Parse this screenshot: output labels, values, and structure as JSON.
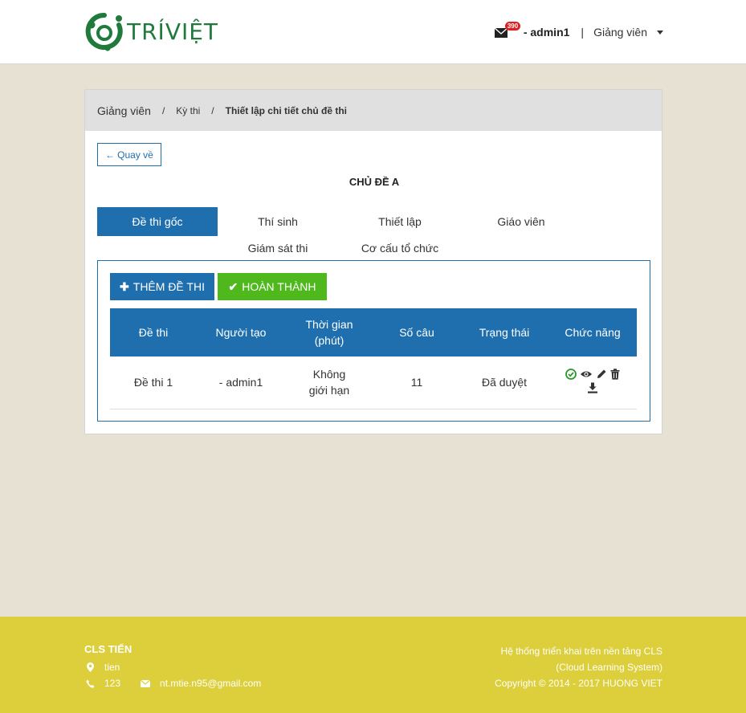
{
  "header": {
    "logo_text": "TRÍVIỆT",
    "mail_count": "390",
    "user": "- admin1",
    "separator": "|",
    "role": "Giảng viên"
  },
  "breadcrumb": {
    "items": [
      "Giảng viên",
      "Kỳ thi",
      "Thiết lập chi tiết chủ đề thi"
    ],
    "separator": "/"
  },
  "page": {
    "back_label": "Quay về",
    "title": "CHỦ ĐỀ A"
  },
  "tabs": [
    "Đề thi gốc",
    "Thí sinh",
    "Thiết lập",
    "Giáo viên",
    "Giám sát thi",
    "Cơ cấu tổ chức"
  ],
  "toolbar": {
    "add_label": "THÊM ĐỀ THI",
    "done_label": "HOÀN THÀNH"
  },
  "table": {
    "headers": [
      "Đề thi",
      "Người tạo",
      "Thời gian (phút)",
      "Số câu",
      "Trạng thái",
      "Chức năng"
    ],
    "rows": [
      [
        "Đề thi 1",
        "- admin1",
        "Không giới hạn",
        "11",
        "Đã duyệt"
      ]
    ]
  },
  "footer": {
    "brand": "CLS TIẾN",
    "address": "tien",
    "phone": "123",
    "email": "nt.mtie.n95@gmail.com",
    "right_line1": "Hệ thống triển khai trên nền tảng CLS",
    "right_line2": "(Cloud Learning System)",
    "right_line3": "Copyright © 2014 - 2017 HUONG VIET"
  },
  "colors": {
    "primary": "#1f6fae",
    "success": "#4fb81c",
    "footer": "#dccf3b",
    "background": "#e7e1d3",
    "logo": "#1f7a3c"
  }
}
